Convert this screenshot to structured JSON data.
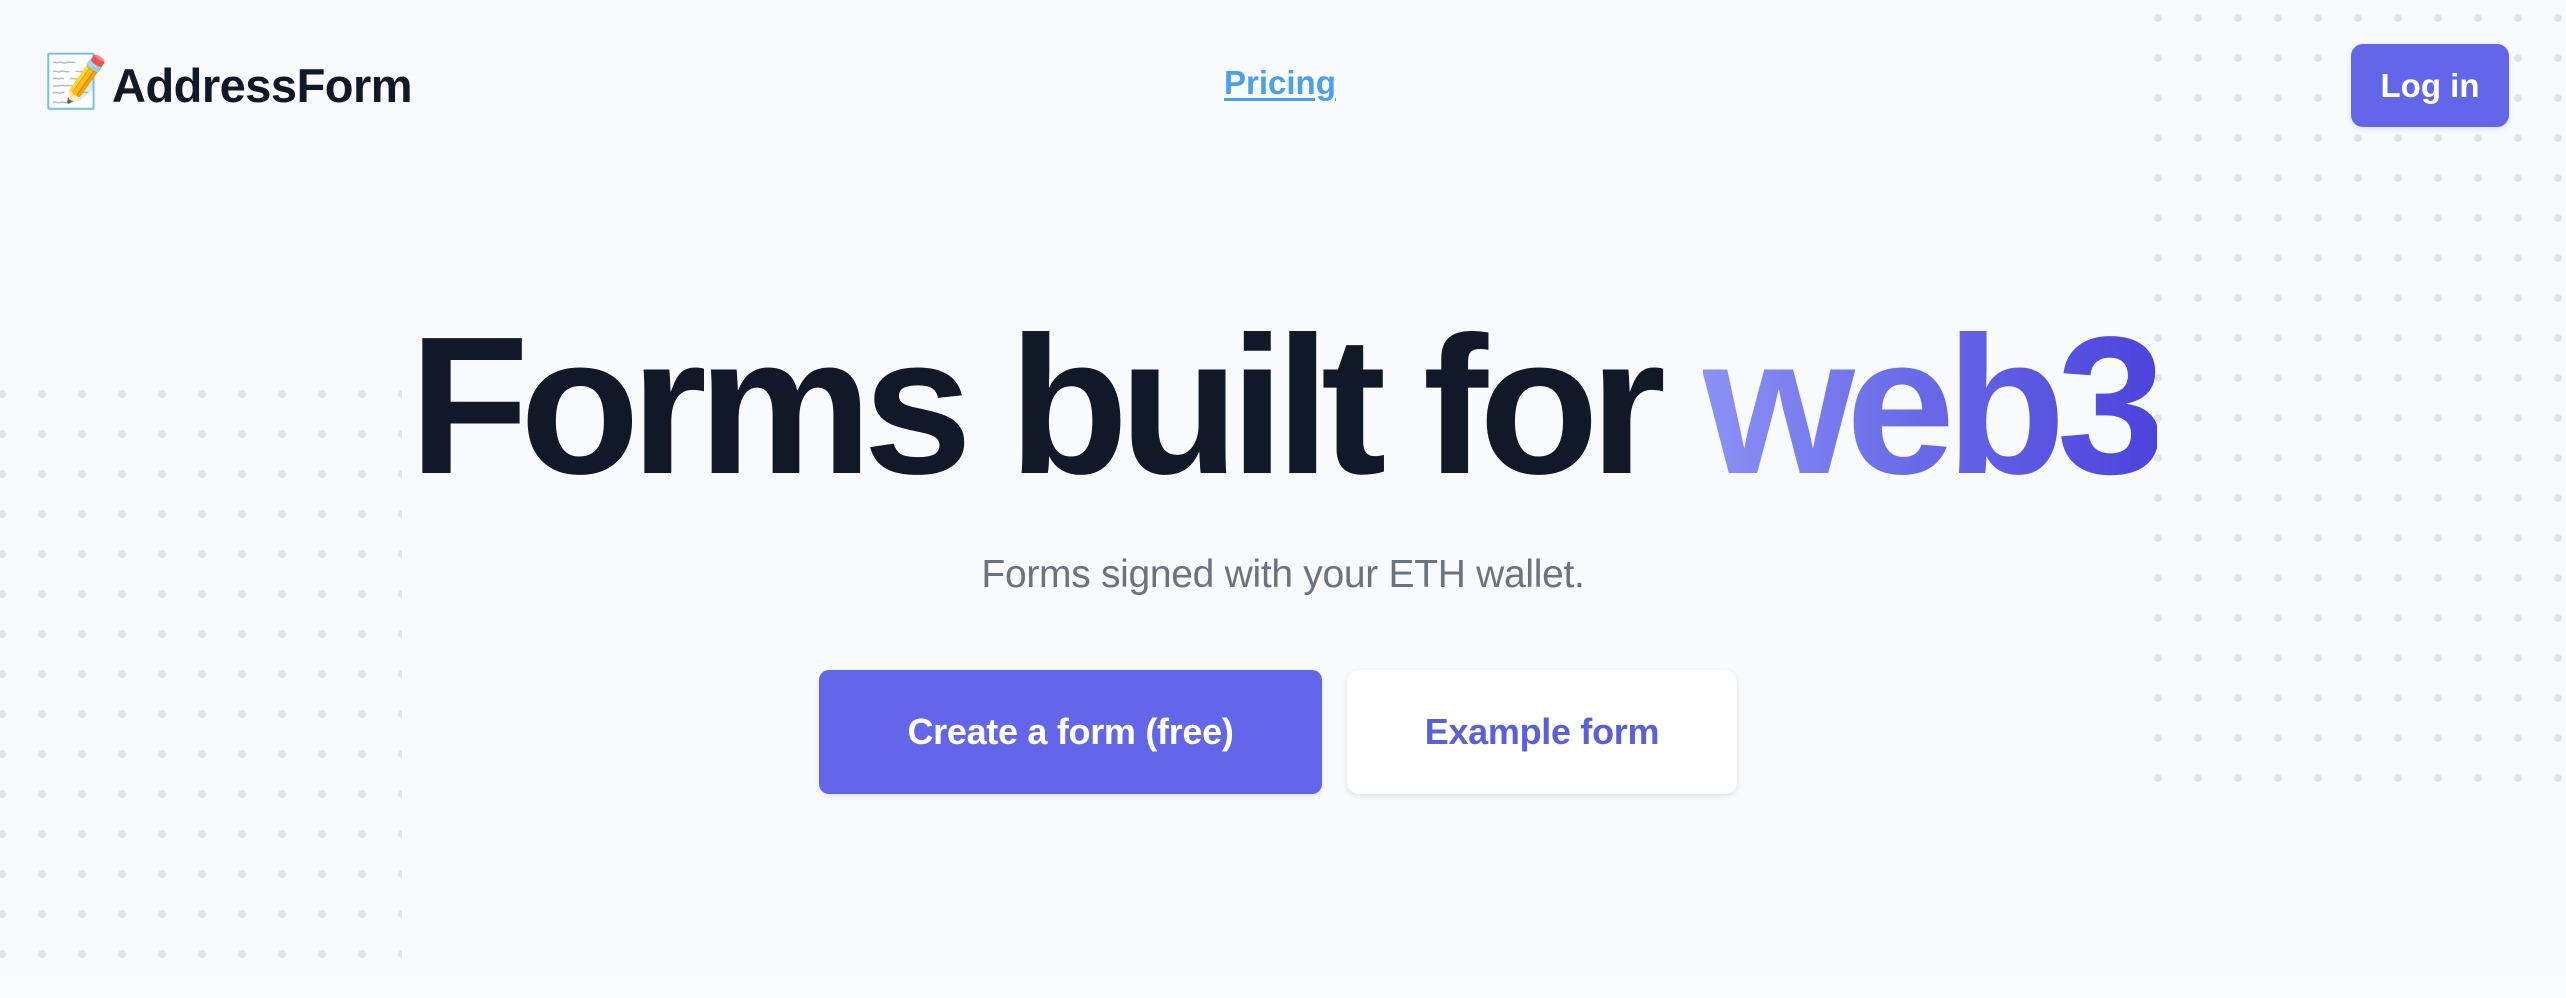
{
  "header": {
    "logo": {
      "icon": "memo-emoji-icon",
      "icon_glyph": "📝",
      "name": "AddressForm"
    },
    "nav": {
      "pricing_label": "Pricing"
    },
    "login_label": "Log in"
  },
  "hero": {
    "title_plain": "Forms built for ",
    "title_highlight": "web3",
    "subtitle": "Forms signed with your ETH wallet.",
    "primary_cta_label": "Create a form (free)",
    "secondary_cta_label": "Example form"
  },
  "colors": {
    "background": "#f9fafb",
    "text_dark": "#111827",
    "text_muted": "#6b7280",
    "accent": "#6366f1",
    "link": "#4ba0ea",
    "gradient_start": "#8b92f5",
    "gradient_end": "#4c43dc",
    "dot_pattern": "#e3e4e8"
  }
}
